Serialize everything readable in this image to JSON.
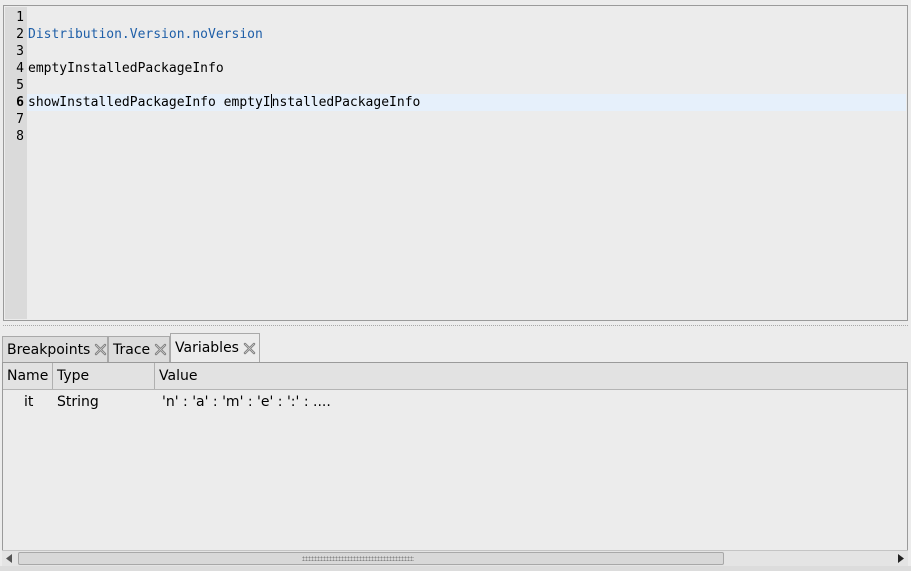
{
  "editor": {
    "line_numbers": [
      "1",
      "2",
      "3",
      "4",
      "5",
      "6",
      "7",
      "8"
    ],
    "current_line": "6",
    "lines": {
      "l2": "Distribution.Version.noVersion",
      "l4": "emptyInstalledPackageInfo",
      "l6_before_caret": "showInstalledPackageInfo emptyI",
      "l6_after_caret": "nstalledPackageInfo"
    }
  },
  "tabs": [
    {
      "label": "Breakpoints",
      "close_icon": "close-x-icon"
    },
    {
      "label": "Trace",
      "close_icon": "close-x-icon"
    },
    {
      "label": "Variables",
      "close_icon": "close-x-icon",
      "active": true
    }
  ],
  "variables": {
    "columns": [
      "Name",
      "Type",
      "Value"
    ],
    "rows": [
      {
        "name": "it",
        "type": "String",
        "value": "'n' : 'a' : 'm' : 'e' : ':' : ...."
      }
    ]
  },
  "scrollbar": {
    "left_icon": "arrow-left-icon",
    "right_icon": "arrow-right-icon"
  }
}
